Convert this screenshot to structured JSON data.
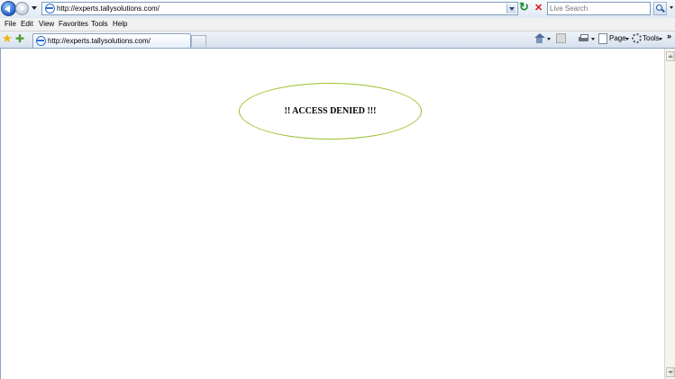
{
  "address_bar": {
    "url": "http://experts.tallysolutions.com/"
  },
  "search": {
    "placeholder": "Live Search"
  },
  "menu": {
    "items": [
      "File",
      "Edit",
      "View",
      "Favorites",
      "Tools",
      "Help"
    ]
  },
  "tab": {
    "label": "http://experts.tallysolutions.com/"
  },
  "command_bar": {
    "page_label": "Page",
    "tools_label": "Tools",
    "chevron": "»"
  },
  "content": {
    "message": "!! ACCESS DENIED !!!"
  },
  "icons": {
    "back": "back-arrow-icon",
    "forward": "forward-arrow-icon",
    "refresh": "refresh-icon",
    "stop": "stop-icon",
    "search": "magnifier-icon",
    "favorites": "star-icon",
    "add_favorites": "add-favorites-icon",
    "home": "home-icon",
    "feeds": "feeds-icon",
    "print": "printer-icon",
    "page": "page-icon",
    "tools": "gear-icon"
  },
  "colors": {
    "ellipse_outline": "#9ac12b",
    "toolbar_border": "#8fa3bf",
    "back_button": "#1f5fc7"
  }
}
